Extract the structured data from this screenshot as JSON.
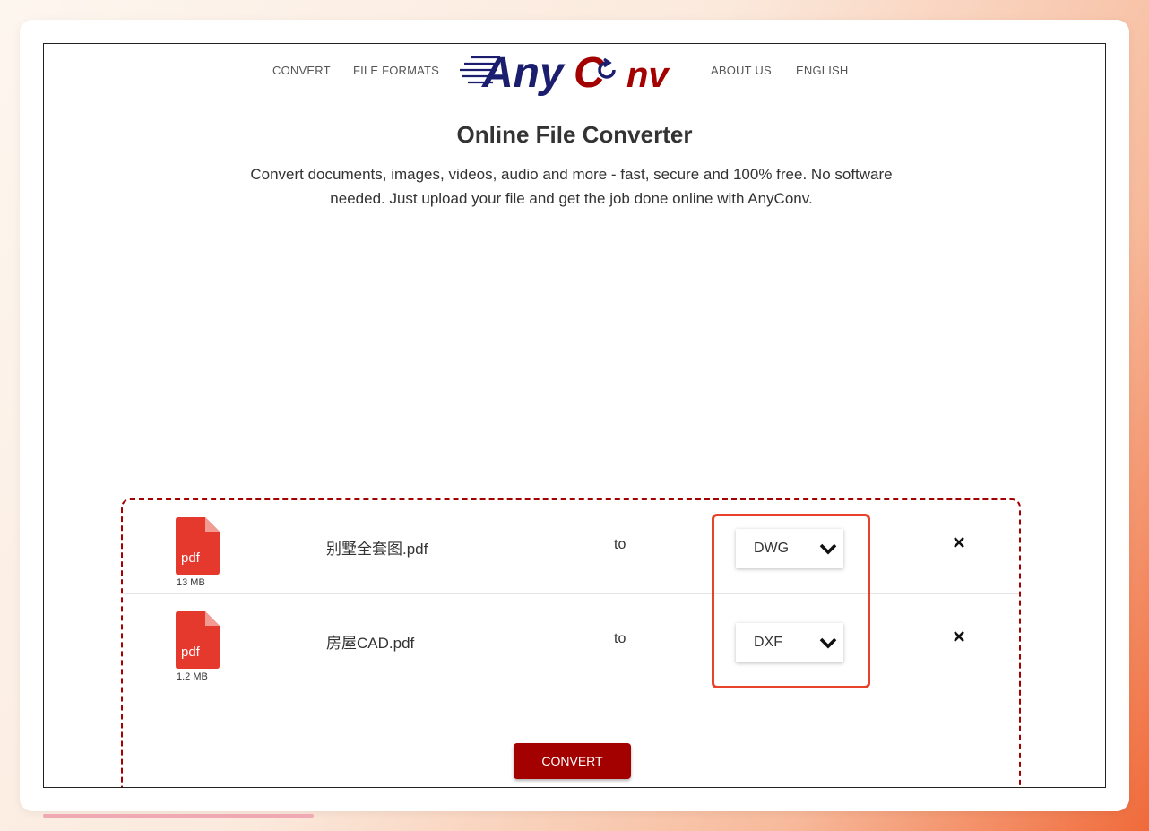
{
  "nav": {
    "convert": "CONVERT",
    "file_formats": "FILE FORMATS",
    "about_us": "ABOUT US",
    "language": "ENGLISH"
  },
  "logo": {
    "part1": "Any",
    "part2": "C",
    "part3": "nv"
  },
  "hero": {
    "title": "Online File Converter",
    "subtitle": "Convert documents, images, videos, audio and more - fast, secure and 100% free. No software needed. Just upload your file and get the job done online with AnyConv."
  },
  "files": [
    {
      "icon_label": "pdf",
      "name": "别墅全套图.pdf",
      "size": "13 MB",
      "to": "to",
      "target_format": "DWG"
    },
    {
      "icon_label": "pdf",
      "name": "房屋CAD.pdf",
      "size": "1.2 MB",
      "to": "to",
      "target_format": "DXF"
    }
  ],
  "convert_button": "CONVERT",
  "colors": {
    "brand_navy": "#1b1d6e",
    "brand_red": "#a30000",
    "pdf_icon": "#e5392e",
    "highlight": "#e8432a"
  },
  "icons": {
    "file": "pdf-file-icon",
    "dropdown": "chevron-down-icon",
    "remove": "close-icon"
  }
}
